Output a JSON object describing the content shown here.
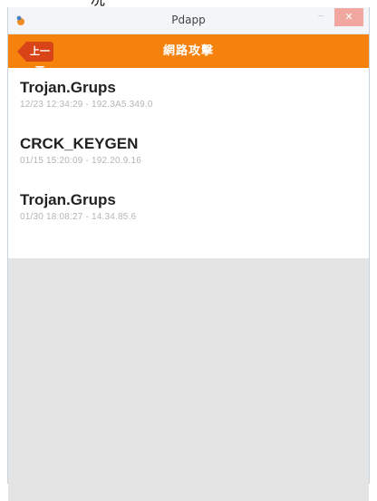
{
  "top_fragment": "况",
  "window": {
    "title": "Pdapp",
    "minimize_glyph": "–",
    "maximize_glyph": "□",
    "close_glyph": "✕"
  },
  "header": {
    "back_label": "上一頁",
    "title": "網路攻擊"
  },
  "colors": {
    "accent": "#f5820d",
    "close_button": "#f1a7a0"
  },
  "items": [
    {
      "title": "Trojan.Grups",
      "subtitle": "12/23 12:34:29 - 192.3A5.349.0"
    },
    {
      "title": "CRCK_KEYGEN",
      "subtitle": "01/15 15:20:09 - 192.20.9.16"
    },
    {
      "title": "Trojan.Grups",
      "subtitle": "01/30 18:08:27 - 14.34.85.6"
    }
  ]
}
